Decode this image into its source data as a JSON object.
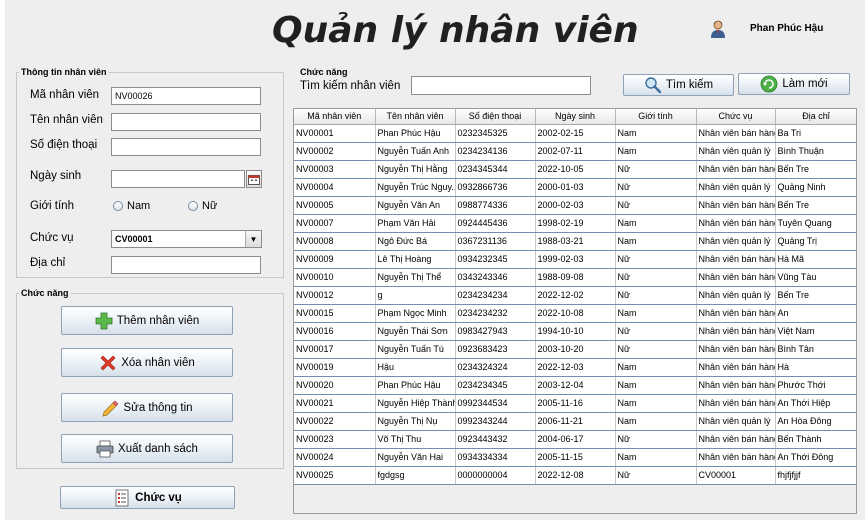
{
  "header": {
    "title": "Quản lý nhân viên",
    "user_name": "Phan Phúc Hậu"
  },
  "info_panel": {
    "title": "Thông tin nhân viên",
    "labels": {
      "id": "Mã nhân viên",
      "name": "Tên nhân viên",
      "phone": "Số điện thoại",
      "dob": "Ngày sinh",
      "gender": "Giới tính",
      "position": "Chức vụ",
      "address": "Địa chỉ"
    },
    "values": {
      "id": "NV00026",
      "name": "",
      "phone": "",
      "dob": "",
      "position": "CV00001",
      "address": ""
    },
    "gender_options": [
      "Nam",
      "Nữ"
    ]
  },
  "actions_panel": {
    "title": "Chức năng",
    "add_label": "Thêm nhân viên",
    "delete_label": "Xóa nhân viên",
    "edit_label": "Sửa thông tin",
    "export_label": "Xuất danh sách"
  },
  "position_button_label": "Chức vụ",
  "search_panel": {
    "title": "Chức năng",
    "search_label": "Tìm kiếm nhân viên",
    "search_value": "",
    "search_button": "Tìm kiếm",
    "refresh_button": "Làm mới"
  },
  "table": {
    "columns": [
      "Mã nhân viên",
      "Tên nhân viên",
      "Số điện thoại",
      "Ngày sinh",
      "Giới tính",
      "Chức vụ",
      "Địa chỉ"
    ],
    "rows": [
      [
        "NV00001",
        "Phan Phúc Hậu",
        "0232345325",
        "2002-02-15",
        "Nam",
        "Nhân viên bán hàng",
        "Ba Tri"
      ],
      [
        "NV00002",
        "Nguyễn Tuấn Anh",
        "0234234136",
        "2002-07-11",
        "Nam",
        "Nhân viên quản lý",
        "Bình Thuận"
      ],
      [
        "NV00003",
        "Nguyễn Thị Hằng",
        "0234345344",
        "2022-10-05",
        "Nữ",
        "Nhân viên bán hàng",
        "Bến Tre"
      ],
      [
        "NV00004",
        "Nguyễn Trúc Nguy...",
        "0932866736",
        "2000-01-03",
        "Nữ",
        "Nhân viên quản lý",
        "Quảng Ninh"
      ],
      [
        "NV00005",
        "Nguyễn Văn An",
        "0988774336",
        "2000-02-03",
        "Nữ",
        "Nhân viên bán hàng",
        "Bến Tre"
      ],
      [
        "NV00007",
        "Phạm Văn Hải",
        "0924445436",
        "1998-02-19",
        "Nam",
        "Nhân viên bán hàng",
        "Tuyên Quang"
      ],
      [
        "NV00008",
        "Ngô Đức Bá",
        "0367231136",
        "1988-03-21",
        "Nam",
        "Nhân viên quản lý",
        "Quảng Trị"
      ],
      [
        "NV00009",
        "Lê Thị Hoàng",
        "0934232345",
        "1999-02-03",
        "Nữ",
        "Nhân viên bán hàng",
        "Hà Mã"
      ],
      [
        "NV00010",
        "Nguyễn Thị Thể",
        "0343243346",
        "1988-09-08",
        "Nữ",
        "Nhân viên bán hàng",
        "Vũng Tàu"
      ],
      [
        "NV00012",
        "g",
        "0234234234",
        "2022-12-02",
        "Nữ",
        "Nhân viên quản lý",
        "Bến Tre"
      ],
      [
        "NV00015",
        "Phạm Ngọc Minh",
        "0234234232",
        "2022-10-08",
        "Nam",
        "Nhân viên bán hàng",
        "An"
      ],
      [
        "NV00016",
        "Nguyễn Thái Sơn",
        "0983427943",
        "1994-10-10",
        "Nữ",
        "Nhân viên bán hàng",
        "Việt Nam"
      ],
      [
        "NV00017",
        "Nguyễn Tuấn Tú",
        "0923683423",
        "2003-10-20",
        "Nữ",
        "Nhân viên bán hàng",
        "Bình Tân"
      ],
      [
        "NV00019",
        "Hậu",
        "0234324324",
        "2022-12-03",
        "Nam",
        "Nhân viên bán hàng",
        "Hà"
      ],
      [
        "NV00020",
        "Phan Phúc Hậu",
        "0234234345",
        "2003-12-04",
        "Nam",
        "Nhân viên bán hàng",
        "Phước Thới"
      ],
      [
        "NV00021",
        "Nguyễn Hiệp Thành",
        "0992344534",
        "2005-11-16",
        "Nam",
        "Nhân viên bán hàng",
        "An Thới Hiệp"
      ],
      [
        "NV00022",
        "Nguyễn Thị Nụ",
        "0992343244",
        "2006-11-21",
        "Nam",
        "Nhân viên quản lý",
        "An Hòa Đông"
      ],
      [
        "NV00023",
        "Võ Thị Thu",
        "0923443432",
        "2004-06-17",
        "Nữ",
        "Nhân viên bán hàng",
        "Bến Thành"
      ],
      [
        "NV00024",
        "Nguyễn Văn Hai",
        "0934334334",
        "2005-11-15",
        "Nam",
        "Nhân viên bán hàng",
        "An Thới Đông"
      ],
      [
        "NV00025",
        "fgdgsg",
        "0000000004",
        "2022-12-08",
        "Nữ",
        "CV00001",
        "fhjfjfjjf"
      ]
    ]
  }
}
